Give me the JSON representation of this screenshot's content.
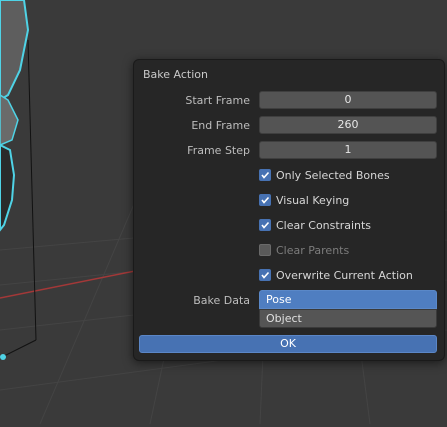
{
  "dialog": {
    "title": "Bake Action",
    "fields": [
      {
        "label": "Start Frame",
        "value": "0"
      },
      {
        "label": "End Frame",
        "value": "260"
      },
      {
        "label": "Frame Step",
        "value": "1"
      }
    ],
    "checkboxes": [
      {
        "label": "Only Selected Bones",
        "checked": true,
        "enabled": true
      },
      {
        "label": "Visual Keying",
        "checked": true,
        "enabled": true
      },
      {
        "label": "Clear Constraints",
        "checked": true,
        "enabled": true
      },
      {
        "label": "Clear Parents",
        "checked": false,
        "enabled": false
      },
      {
        "label": "Overwrite Current Action",
        "checked": true,
        "enabled": true
      }
    ],
    "bake_data": {
      "label": "Bake Data",
      "options": [
        "Pose",
        "Object"
      ],
      "selected": "Pose"
    },
    "ok_label": "OK"
  },
  "colors": {
    "accent": "#4772b3",
    "dialog_bg": "#262626",
    "viewport_bg": "#3a3a3a",
    "selection_outline": "#4fd3e6"
  }
}
